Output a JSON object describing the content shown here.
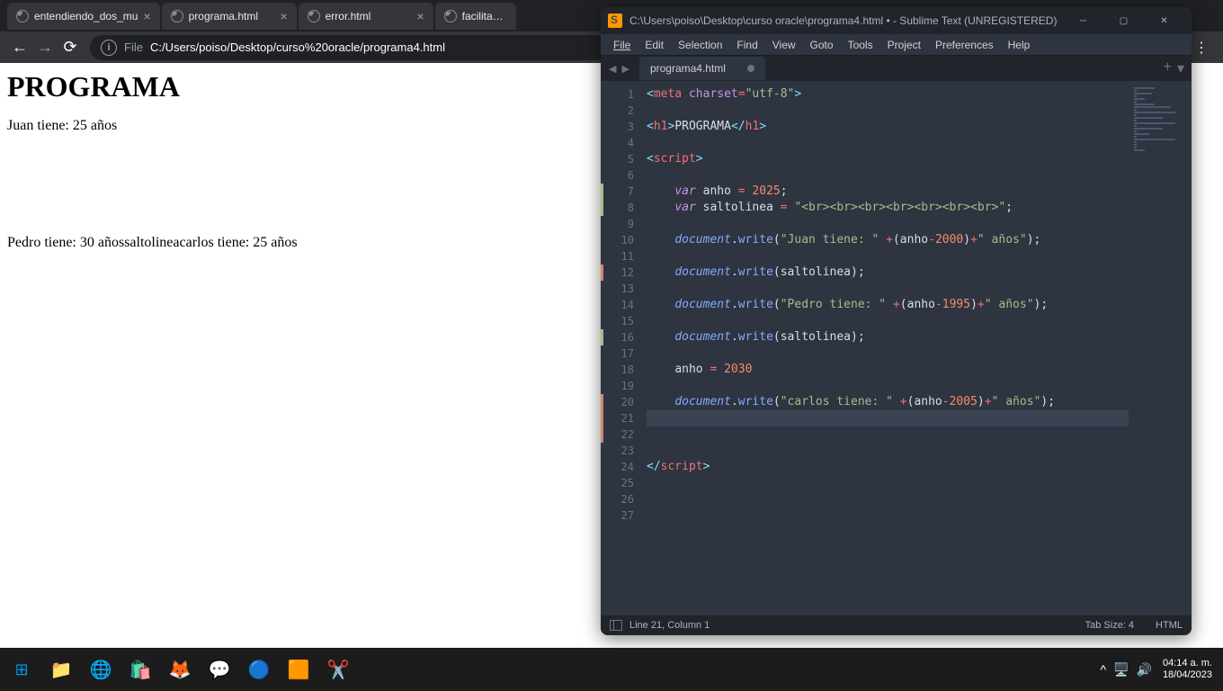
{
  "browser": {
    "tabs": [
      {
        "title": "entendiendo_dos_mu"
      },
      {
        "title": "programa.html"
      },
      {
        "title": "error.html"
      },
      {
        "title": "facilitando.htm"
      }
    ],
    "url_label": "File",
    "url": "C:/Users/poiso/Desktop/curso%20oracle/programa4.html",
    "page_heading": "PROGRAMA",
    "page_text1": "Juan tiene: 25 años",
    "page_text2": "Pedro tiene: 30 añossaltolineacarlos tiene: 25 años"
  },
  "sublime": {
    "title": "C:\\Users\\poiso\\Desktop\\curso oracle\\programa4.html • - Sublime Text (UNREGISTERED)",
    "menus": [
      "File",
      "Edit",
      "Selection",
      "Find",
      "View",
      "Goto",
      "Tools",
      "Project",
      "Preferences",
      "Help"
    ],
    "tab": "programa4.html",
    "status_position": "Line 21, Column 1",
    "status_tabsize": "Tab Size: 4",
    "status_lang": "HTML",
    "code": {
      "l1_tag1": "<",
      "l1_tag2": "meta",
      "l1_attr": "charset",
      "l1_eq": "=",
      "l1_str": "\"utf-8\"",
      "l1_tag3": ">",
      "l3_o1": "<",
      "l3_o2": "h1",
      "l3_o3": ">",
      "l3_txt": "PROGRAMA",
      "l3_c1": "</",
      "l3_c2": "h1",
      "l3_c3": ">",
      "l5_o1": "<",
      "l5_o2": "script",
      "l5_o3": ">",
      "l7_kw": "var",
      "l7_var": " anho ",
      "l7_op": "=",
      "l7_num": " 2025",
      "l7_s": ";",
      "l8_kw": "var",
      "l8_var": " saltolinea ",
      "l8_op": "=",
      "l8_str": " \"<br><br><br><br><br><br><br>\"",
      "l8_s": ";",
      "l10_obj": "document",
      "l10_d": ".",
      "l10_m": "write",
      "l10_p1": "(",
      "l10_str": "\"Juan tiene: \"",
      "l10_plus1": " +",
      "l10_p2": "(",
      "l10_v": "anho",
      "l10_minus": "-",
      "l10_n": "2000",
      "l10_p3": ")",
      "l10_plus2": "+",
      "l10_str2": "\" años\"",
      "l10_p4": ")",
      "l10_s": ";",
      "l12_obj": "document",
      "l12_d": ".",
      "l12_m": "write",
      "l12_p1": "(",
      "l12_v": "saltolinea",
      "l12_p2": ")",
      "l12_s": ";",
      "l14_obj": "document",
      "l14_d": ".",
      "l14_m": "write",
      "l14_p1": "(",
      "l14_str": "\"Pedro tiene: \"",
      "l14_plus1": " +",
      "l14_p2": "(",
      "l14_v": "anho",
      "l14_minus": "-",
      "l14_n": "1995",
      "l14_p3": ")",
      "l14_plus2": "+",
      "l14_str2": "\" años\"",
      "l14_p4": ")",
      "l14_s": ";",
      "l16_obj": "document",
      "l16_d": ".",
      "l16_m": "write",
      "l16_p1": "(",
      "l16_v": "saltolinea",
      "l16_p2": ")",
      "l16_s": ";",
      "l18_v": "anho ",
      "l18_op": "=",
      "l18_n": " 2030",
      "l20_obj": "document",
      "l20_d": ".",
      "l20_m": "write",
      "l20_p1": "(",
      "l20_str": "\"carlos tiene: \"",
      "l20_plus1": " +",
      "l20_p2": "(",
      "l20_v": "anho",
      "l20_minus": "-",
      "l20_n": "2005",
      "l20_p3": ")",
      "l20_plus2": "+",
      "l20_str2": "\" años\"",
      "l20_p4": ")",
      "l20_s": ";",
      "l24_c1": "</",
      "l24_c2": "script",
      "l24_c3": ">"
    }
  },
  "taskbar": {
    "time": "04:14 a. m.",
    "date": "18/04/2023"
  }
}
